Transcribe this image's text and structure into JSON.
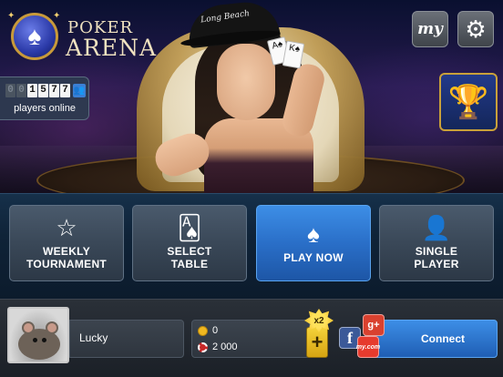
{
  "brand": {
    "line1": "POKER",
    "line2": "ARENA",
    "logo_icon": "spade-icon"
  },
  "hero": {
    "cap_text": "Long Beach",
    "card1": "A♠",
    "card2": "K♠"
  },
  "top_buttons": {
    "my_label": "my",
    "settings_icon": "gear-icon"
  },
  "online": {
    "digits": [
      "0",
      "0",
      "1",
      "5",
      "7",
      "7"
    ],
    "label": "players online"
  },
  "trophy": {
    "icon": "trophy-icon"
  },
  "menu": [
    {
      "id": "weekly-tournament",
      "icon": "star-icon",
      "line1": "WEEKLY",
      "line2": "TOURNAMENT",
      "primary": false
    },
    {
      "id": "select-table",
      "icon": "cards-icon",
      "line1": "SELECT",
      "line2": "TABLE",
      "primary": false
    },
    {
      "id": "play-now",
      "icon": "spade-icon",
      "line1": "PLAY NOW",
      "line2": "",
      "primary": true
    },
    {
      "id": "single-player",
      "icon": "person-icon",
      "line1": "SINGLE",
      "line2": "PLAYER",
      "primary": false
    }
  ],
  "player": {
    "name": "Lucky",
    "coins": "0",
    "chips": "2 000"
  },
  "bonus": {
    "multiplier": "x2",
    "plus": "+"
  },
  "connect": {
    "label": "Connect",
    "facebook": "f",
    "gplus": "g+",
    "mycom": "my.com"
  },
  "colors": {
    "primary_blue": "#2a6fc8",
    "accent_gold": "#c9a13a"
  }
}
